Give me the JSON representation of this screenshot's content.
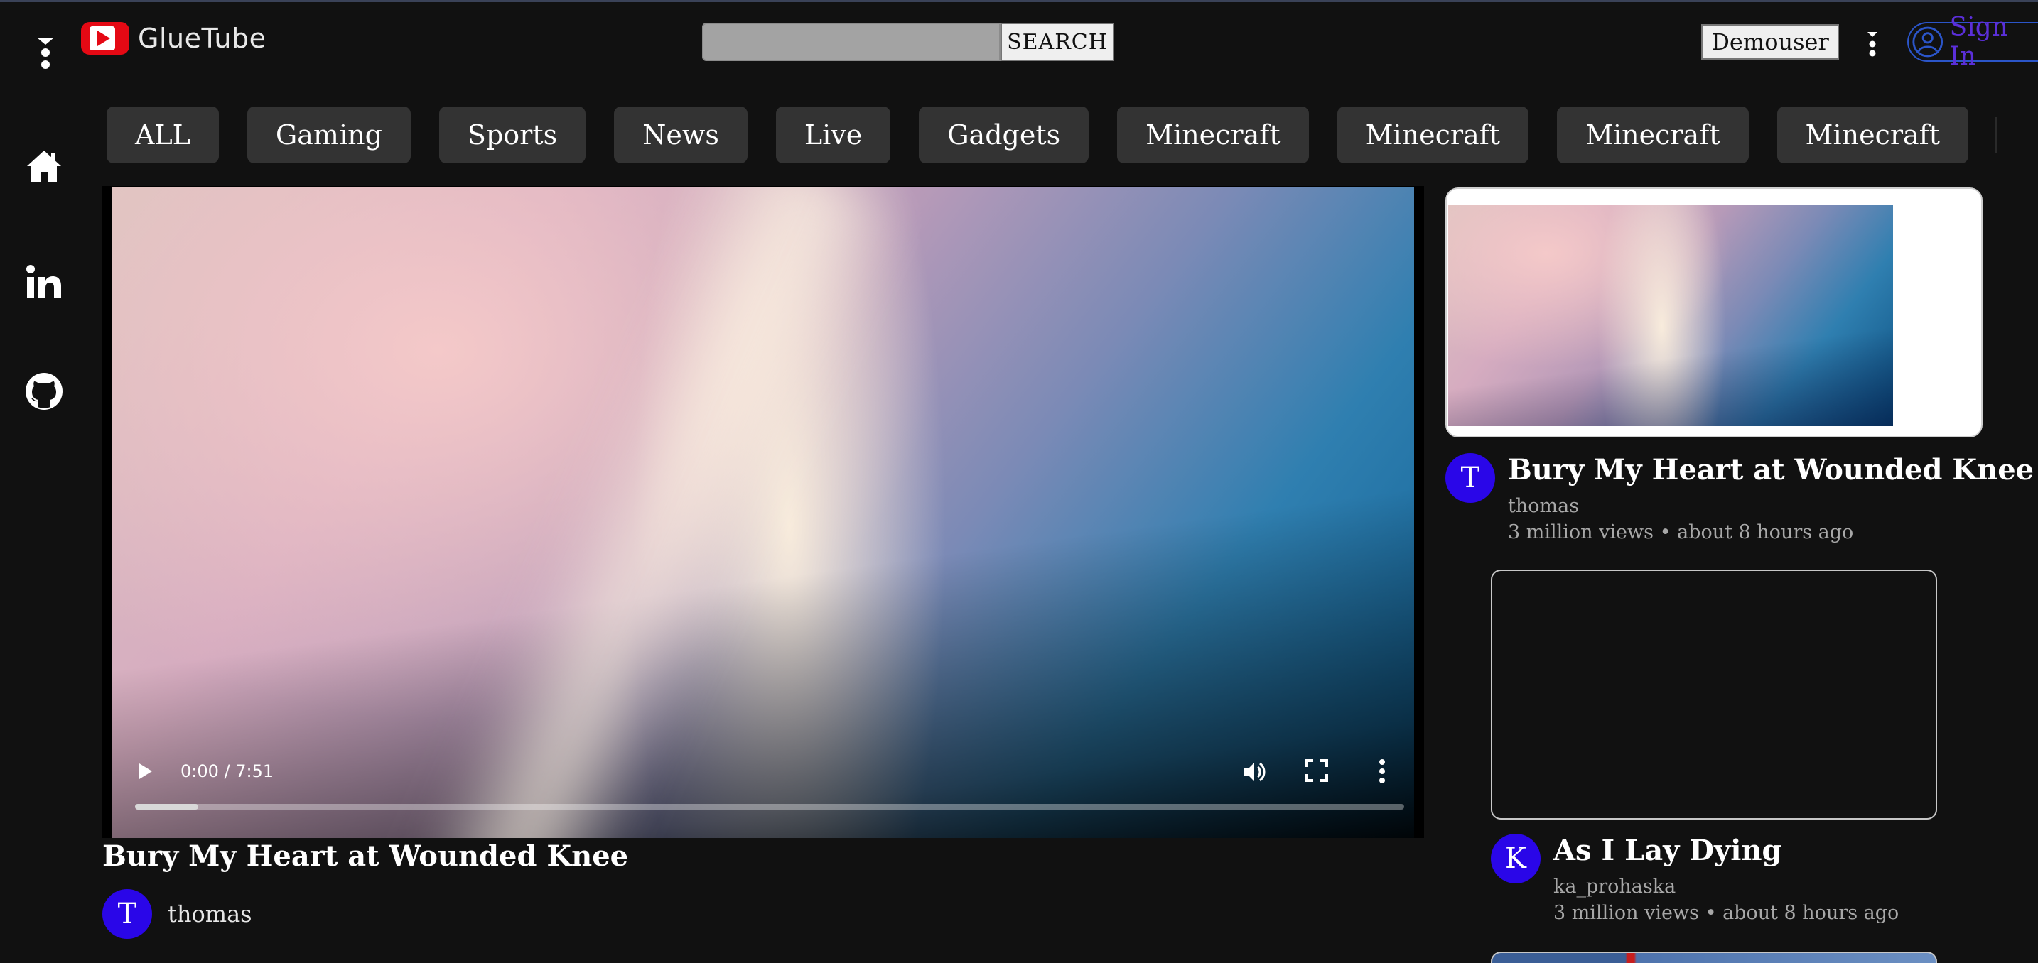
{
  "header": {
    "logo_text": "GlueTube",
    "search_placeholder": "",
    "search_button": "SEARCH",
    "user_button": "Demouser",
    "sign_in": "Sign In"
  },
  "sidebar": {
    "items": [
      {
        "icon": "home-icon"
      },
      {
        "icon": "linkedin-icon"
      },
      {
        "icon": "github-icon"
      }
    ]
  },
  "categories": [
    "ALL",
    "Gaming",
    "Sports",
    "News",
    "Live",
    "Gadgets",
    "Minecraft",
    "Minecraft",
    "Minecraft",
    "Minecraft"
  ],
  "player": {
    "time": "0:00 / 7:51",
    "progress_buffered": 0.05
  },
  "video": {
    "title": "Bury My Heart at Wounded Knee",
    "channel_initial": "T",
    "channel": "thomas"
  },
  "recommendations": [
    {
      "title": "Bury My Heart at Wounded Knee",
      "channel_initial": "T",
      "channel": "thomas",
      "views": "3 million views",
      "age": "about 8 hours ago"
    },
    {
      "title": "As I Lay Dying",
      "channel_initial": "K",
      "channel": "ka_prohaska",
      "views": "3 million views",
      "age": "about 8 hours ago"
    }
  ],
  "colors": {
    "background": "#111111",
    "chip": "#333333",
    "avatar": "#2a06e8",
    "logo_red": "#e50914",
    "sign_in": "#5b2fd9"
  }
}
